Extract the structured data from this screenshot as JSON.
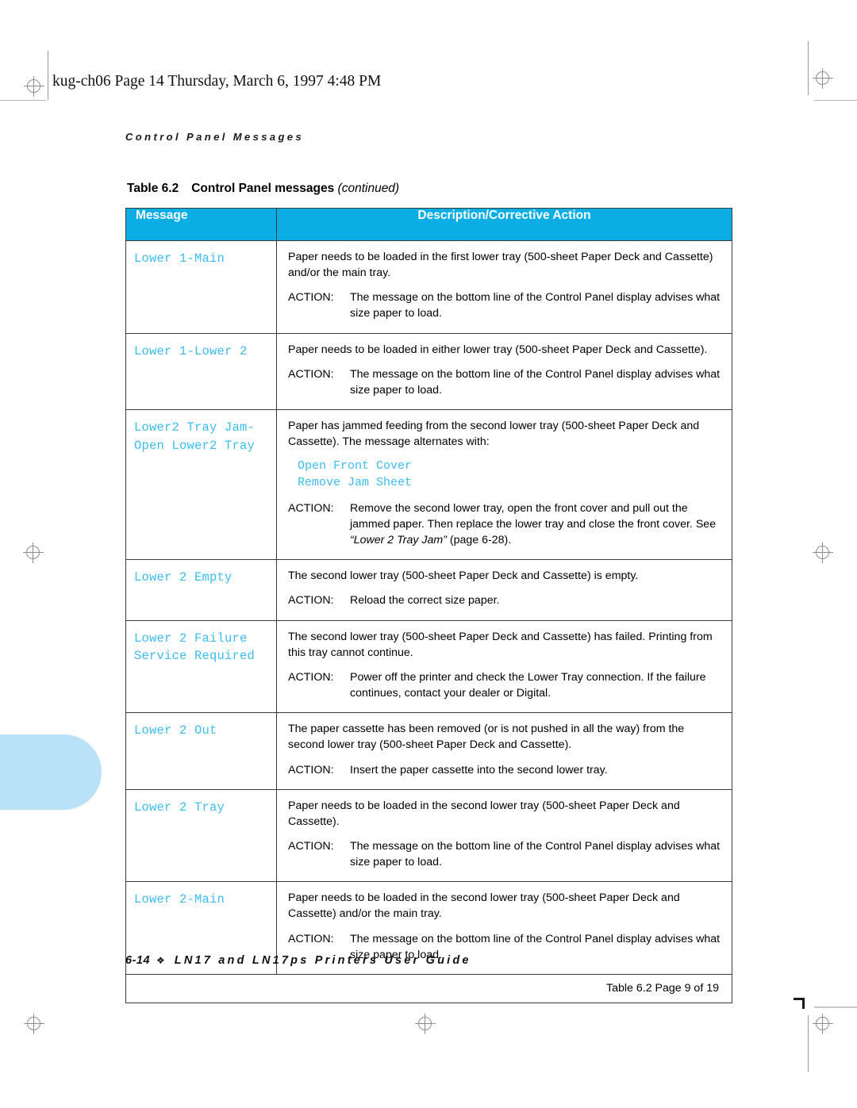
{
  "stamp": "kug-ch06  Page 14  Thursday, March 6, 1997  4:48 PM",
  "running_head": "Control Panel Messages",
  "caption": {
    "label": "Table 6.2",
    "title": "Control Panel messages",
    "continued": "(continued)"
  },
  "colors": {
    "header_blue": "#0aaee4",
    "message_blue": "#3cbcef",
    "index_tab_blue": "#b9e2f8"
  },
  "table": {
    "columns": [
      "Message",
      "Description/Corrective Action"
    ],
    "action_label": "ACTION:",
    "rows": [
      {
        "message": "Lower 1-Main",
        "description": "Paper needs to be loaded in the first lower tray (500-sheet Paper Deck and Cassette) and/or the main tray.",
        "action": "The message on the bottom line of the Control Panel display advises what size paper to load."
      },
      {
        "message": "Lower 1-Lower 2",
        "description": "Paper needs to be loaded in either lower tray (500-sheet Paper Deck and Cassette).",
        "action": "The message on the bottom line of the Control Panel display advises what size paper to load."
      },
      {
        "message": "Lower2 Tray Jam-\nOpen Lower2 Tray",
        "description": "Paper has jammed feeding from the second lower tray (500-sheet Paper Deck and Cassette). The message alternates with:",
        "code_lines": [
          "Open Front Cover",
          "Remove Jam Sheet"
        ],
        "action": "Remove the second lower tray, open the front cover and pull out the jammed paper. Then replace the lower tray and close the front cover. See ",
        "action_ref_quoted": "“Lower 2 Tray Jam”",
        "action_tail": " (page 6-28)."
      },
      {
        "message": "Lower 2 Empty",
        "description": "The second lower tray (500-sheet Paper Deck and Cassette) is empty.",
        "action": "Reload the correct size paper."
      },
      {
        "message": "Lower 2 Failure\nService Required",
        "description": "The second lower tray (500-sheet Paper Deck and Cassette) has failed. Printing from this tray cannot continue.",
        "action": "Power off the printer and check the Lower Tray connection. If the failure continues, contact your dealer or Digital."
      },
      {
        "message": "Lower 2 Out",
        "description": "The paper cassette has been removed (or is not pushed in all the way) from the second lower tray (500-sheet Paper Deck and Cassette).",
        "action": "Insert the paper cassette into the second lower tray."
      },
      {
        "message": "Lower 2 Tray",
        "description": "Paper needs to be loaded in the second lower tray (500-sheet Paper Deck and Cassette).",
        "action": "The message on the bottom line of the Control Panel display advises what size paper to load."
      },
      {
        "message": "Lower 2-Main",
        "description": "Paper needs to be loaded in the second lower tray (500-sheet Paper Deck and Cassette) and/or the main tray.",
        "action": "The message on the bottom line of the Control Panel display advises what size paper to load."
      }
    ],
    "footer_note": "Table 6.2  Page 9 of 19"
  },
  "page_footer": {
    "page_number": "6-14",
    "diamond": "❖",
    "guide_title": "LN17 and LN17ps Printers User Guide"
  }
}
